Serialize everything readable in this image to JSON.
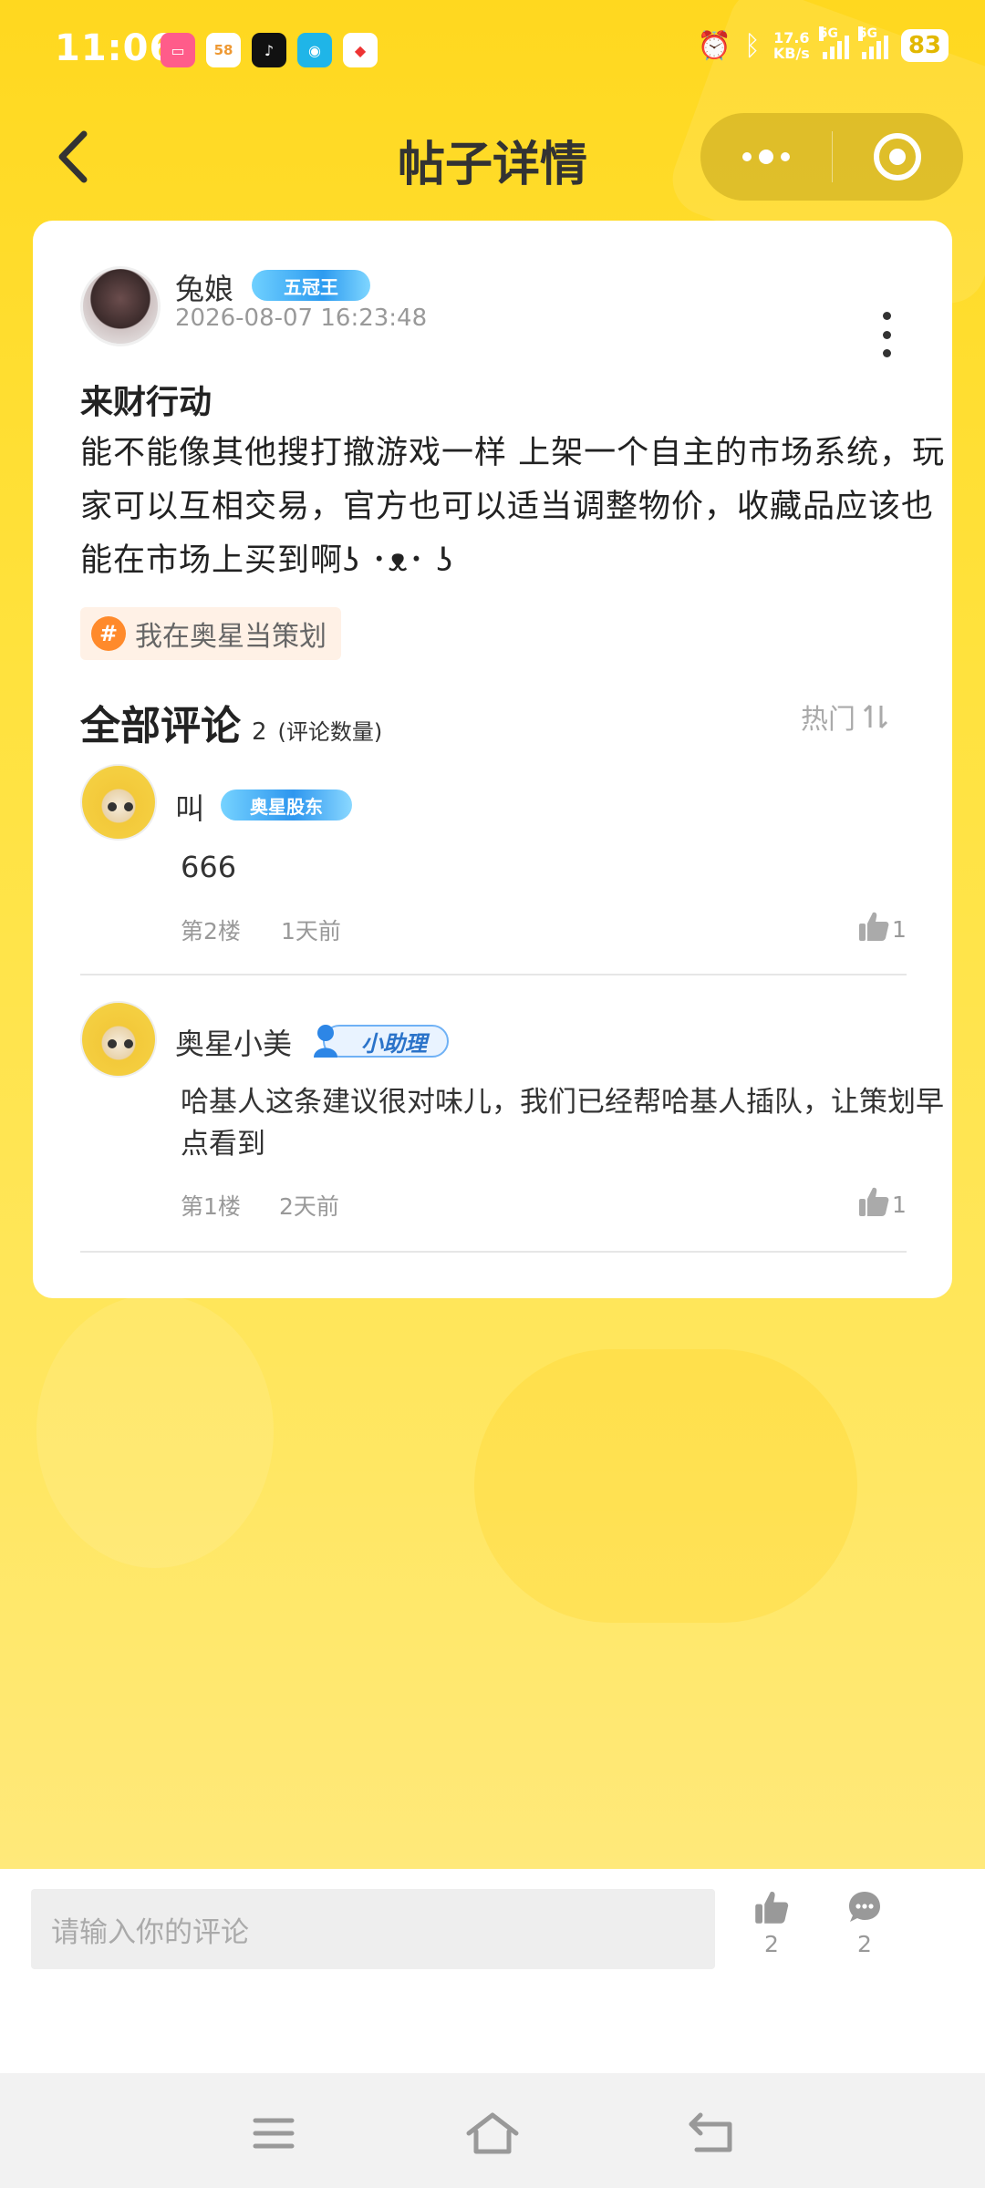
{
  "status_bar": {
    "time": "11:06",
    "app_icons": [
      "bilibili-icon",
      "58-app-icon",
      "tiktok-icon",
      "china-mobile-icon",
      "shopping-app-icon"
    ],
    "net_speed": "17.6",
    "net_unit": "KB/s",
    "sim1_tag": "5G",
    "sim2_tag": "5G",
    "battery": "83"
  },
  "nav": {
    "title": "帖子详情"
  },
  "post": {
    "author": "兔娘",
    "author_badge": "五冠王",
    "time": "2026-08-07 16:23:48",
    "title": "来财行动",
    "body": "能不能像其他搜打撤游戏一样 上架一个自主的市场系统，玩家可以互相交易，官方也可以适当调整物价，收藏品应该也能在市场上买到啊ʖ ･ᴥ･ ʖ",
    "topic": "我在奥星当策划"
  },
  "comments_section": {
    "title": "全部评论",
    "count": "2",
    "note": "(评论数量)",
    "sort_label": "热门"
  },
  "comments": [
    {
      "name": "叫",
      "badge": "奥星股东",
      "text": "666",
      "floor": "第2楼",
      "ago": "1天前",
      "likes": "1"
    },
    {
      "name": "奥星小美",
      "badge": "小助理",
      "text": "哈基人这条建议很对味儿，我们已经帮哈基人插队，让策划早点看到",
      "floor": "第1楼",
      "ago": "2天前",
      "likes": "1"
    }
  ],
  "bottom_bar": {
    "input_placeholder": "请输入你的评论",
    "like_count": "2",
    "comment_count": "2"
  },
  "colors": {
    "background_yellow": "#ffd81f",
    "badge_blue": "#2d9bf0",
    "topic_orange": "#ff8a2b"
  }
}
